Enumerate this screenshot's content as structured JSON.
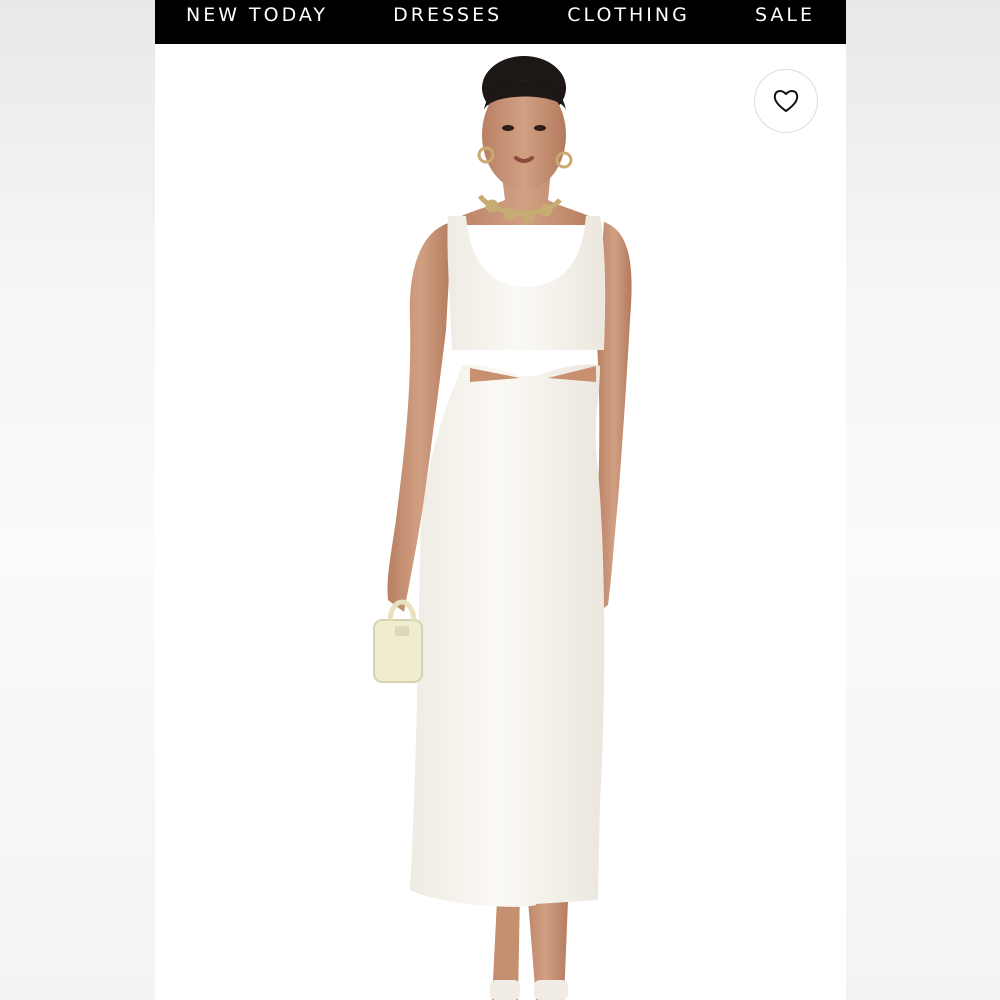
{
  "nav": {
    "items": [
      {
        "label": "NEW TODAY"
      },
      {
        "label": "DRESSES"
      },
      {
        "label": "CLOTHING"
      },
      {
        "label": "SALE"
      }
    ]
  },
  "product": {
    "dress_color": "#f8f5ee",
    "skin_color": "#c99372",
    "wishlist_icon": "heart-outline-icon"
  }
}
